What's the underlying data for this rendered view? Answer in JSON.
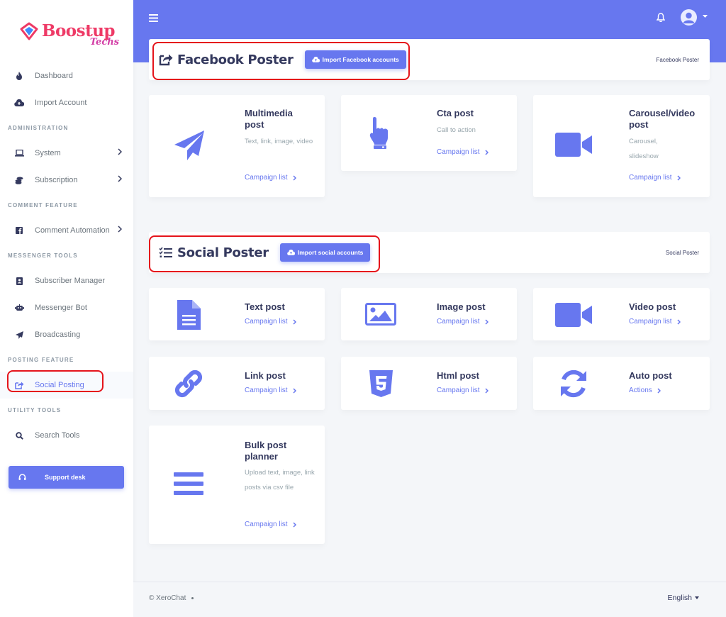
{
  "brand": {
    "name": "Boostup",
    "sub": "Techs"
  },
  "colors": {
    "accent": "#6777ef",
    "highlight": "#e5141b",
    "muted": "#98a6ad",
    "text": "#34395e"
  },
  "sidebar": {
    "items": [
      {
        "id": "dashboard",
        "label": "Dashboard",
        "icon": "fire-icon"
      },
      {
        "id": "import-account",
        "label": "Import Account",
        "icon": "cloud-upload-icon"
      }
    ],
    "headers": {
      "administration": "ADMINISTRATION",
      "comment_feature": "COMMENT FEATURE",
      "messenger_tools": "MESSENGER TOOLS",
      "posting_feature": "POSTING FEATURE",
      "utility_tools": "UTILITY TOOLS"
    },
    "admin_items": [
      {
        "label": "System",
        "icon": "laptop-icon"
      },
      {
        "label": "Subscription",
        "icon": "coins-icon"
      }
    ],
    "comment_items": [
      {
        "label": "Comment Automation",
        "icon": "facebook-square-icon"
      }
    ],
    "messenger_items": [
      {
        "label": "Subscriber Manager",
        "icon": "address-card-icon"
      },
      {
        "label": "Messenger Bot",
        "icon": "robot-icon"
      },
      {
        "label": "Broadcasting",
        "icon": "paper-plane-icon"
      }
    ],
    "posting_items": [
      {
        "label": "Social Posting",
        "icon": "share-square-icon"
      }
    ],
    "utility_items": [
      {
        "label": "Search Tools",
        "icon": "search-icon"
      }
    ],
    "support_label": "Support desk"
  },
  "facebook_section": {
    "title": "Facebook Poster",
    "import_label": "Import Facebook accounts",
    "breadcrumb": "Facebook Poster"
  },
  "facebook_cards": [
    {
      "title": "Multimedia post",
      "desc": "Text, link, image, video",
      "link": "Campaign list",
      "icon": "paper-plane-icon"
    },
    {
      "title": "Cta post",
      "desc": "Call to action",
      "link": "Campaign list",
      "icon": "hand-pointer-icon"
    },
    {
      "title": "Carousel/video post",
      "desc": "Carousel, slideshow",
      "link": "Campaign list",
      "icon": "video-icon"
    }
  ],
  "social_section": {
    "title": "Social Poster",
    "import_label": "Import social accounts",
    "breadcrumb": "Social Poster"
  },
  "social_cards": [
    {
      "title": "Text post",
      "link": "Campaign list",
      "icon": "file-text-icon"
    },
    {
      "title": "Image post",
      "link": "Campaign list",
      "icon": "image-icon"
    },
    {
      "title": "Video post",
      "link": "Campaign list",
      "icon": "video-icon"
    },
    {
      "title": "Link post",
      "link": "Campaign list",
      "icon": "link-icon"
    },
    {
      "title": "Html post",
      "link": "Campaign list",
      "icon": "html5-icon"
    },
    {
      "title": "Auto post",
      "link": "Actions",
      "icon": "sync-icon"
    },
    {
      "title": "Bulk post planner",
      "desc": "Upload text, image, link posts via csv file",
      "link": "Campaign list",
      "icon": "bars-icon"
    }
  ],
  "footer": {
    "copyright": "© XeroChat",
    "language": "English"
  }
}
